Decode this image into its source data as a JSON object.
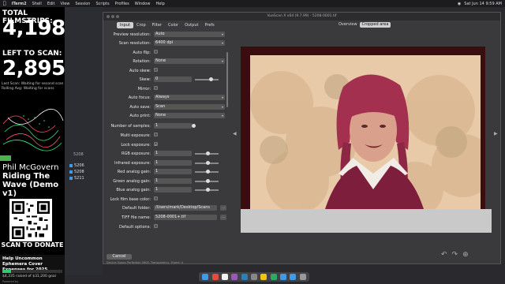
{
  "menubar": {
    "app_name": "iTerm2",
    "items": [
      "Shell",
      "Edit",
      "View",
      "Session",
      "Scripts",
      "Profiles",
      "Window",
      "Help"
    ],
    "clock": "Sat Jun 14 9:59 AM"
  },
  "stats": {
    "total_label": "TOTAL FILMSTRIPS:",
    "total_value": "4,198",
    "left_label": "LEFT TO SCAN:",
    "left_value": "2,895",
    "last_scan": "Last Scan: Waiting for second scan",
    "rolling_avg": "Rolling Avg: Waiting for scans",
    "artist": "Phil McGovern",
    "song": "Riding The Wave (Demo v1)",
    "scan_to_donate": "SCAN TO DONATE",
    "donation_title": "Help Uncommon Ephemera Cover Expenses for 2025",
    "raised_text": "$4,335 raised of $31,200 goal",
    "raised_fraction": 0.139,
    "powered": "Powered by"
  },
  "files": {
    "header": "5208",
    "items": [
      "5206",
      "5208",
      "5211"
    ]
  },
  "vuescan": {
    "window_title": "VueScan X x64 (9.7.99) - 5208-0001.tif",
    "tabs": [
      "Input",
      "Crop",
      "Filter",
      "Color",
      "Output",
      "Prefs"
    ],
    "active_tab": "Input",
    "preview_tabs": [
      "Overview",
      "Cropped area"
    ],
    "active_preview_tab": "Cropped area",
    "cancel": "Cancel",
    "status": "Device: Epson Perfection V600, Transparency, Frame: 4",
    "settings": {
      "preview_resolution": {
        "label": "Preview resolution:",
        "value": "Auto"
      },
      "scan_resolution": {
        "label": "Scan resolution:",
        "value": "6400 dpi"
      },
      "auto_flip": {
        "label": "Auto flip:"
      },
      "rotation": {
        "label": "Rotation:",
        "value": "None"
      },
      "auto_skew": {
        "label": "Auto skew:"
      },
      "skew": {
        "label": "Skew:",
        "value": "0"
      },
      "mirror": {
        "label": "Mirror:"
      },
      "auto_focus": {
        "label": "Auto focus:",
        "value": "Always"
      },
      "auto_save": {
        "label": "Auto save:",
        "value": "Scan"
      },
      "auto_print": {
        "label": "Auto print:",
        "value": "None"
      },
      "num_samples": {
        "label": "Number of samples:",
        "value": "1"
      },
      "multi_exposure": {
        "label": "Multi exposure:"
      },
      "lock_exposure": {
        "label": "Lock exposure:",
        "checked": "✓"
      },
      "rgb_exposure": {
        "label": "RGB exposure:",
        "value": "1"
      },
      "infrared_exposure": {
        "label": "Infrared exposure:",
        "value": "1"
      },
      "red_gain": {
        "label": "Red analog gain:",
        "value": "1"
      },
      "green_gain": {
        "label": "Green analog gain:",
        "value": "1"
      },
      "blue_gain": {
        "label": "Blue analog gain:",
        "value": "1"
      },
      "lock_film_base": {
        "label": "Lock film base color:"
      },
      "default_folder": {
        "label": "Default folder:",
        "value": "/Users/mark/Desktop/Scans"
      },
      "tiff_file_name": {
        "label": "TIFF file name:",
        "value": "5208-0001+.tif"
      },
      "default_options": {
        "label": "Default options:"
      }
    }
  },
  "colors": {
    "accent_green": "#2ecc71",
    "photo_frame": "#3a0e0e"
  }
}
